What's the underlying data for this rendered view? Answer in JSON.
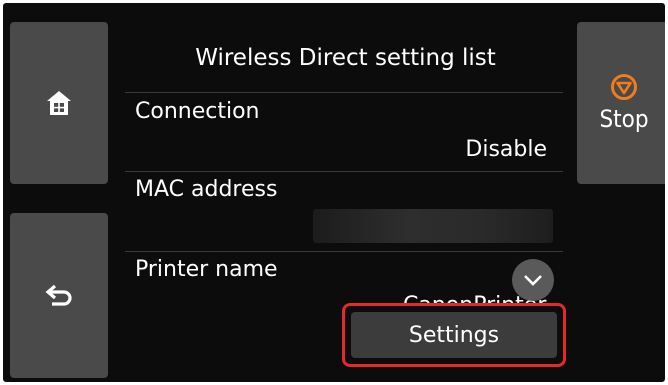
{
  "header": {
    "title": "Wireless Direct setting list"
  },
  "nav": {
    "home_icon": "home-icon",
    "back_icon": "back-arrow-icon",
    "stop_icon": "stop-icon",
    "stop_label": "Stop"
  },
  "list": {
    "items": [
      {
        "label": "Connection",
        "value": "Disable"
      },
      {
        "label": "MAC address",
        "value": ""
      },
      {
        "label": "Printer name",
        "value": "CanonPrinter"
      }
    ]
  },
  "actions": {
    "settings_label": "Settings"
  },
  "colors": {
    "screen_bg": "#0c0c0c",
    "button_bg": "#4a4a4a",
    "stop_accent": "#f07c1e",
    "highlight": "#e22a2a"
  }
}
